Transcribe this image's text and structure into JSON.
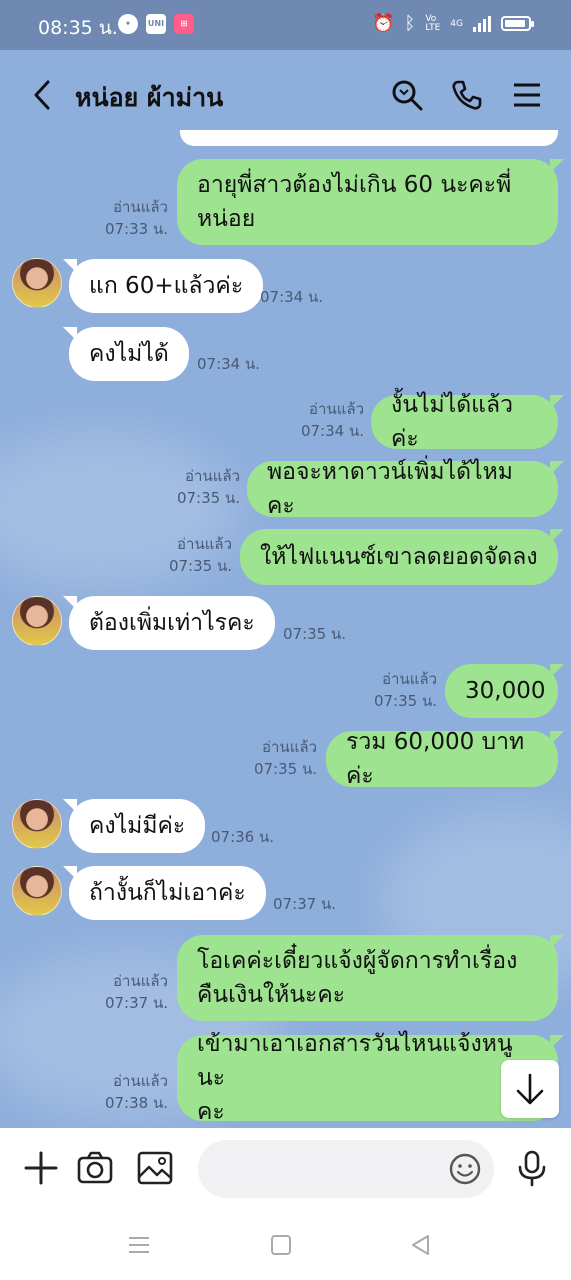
{
  "status": {
    "time": "08:35 น.",
    "net": "4G"
  },
  "chat": {
    "title": "หน่อย ผ้าม่าน"
  },
  "messages": [
    {
      "side": "right",
      "text_lines": [
        "อายุพี่สาวต้องไม่เกิน 60 นะคะพี่",
        "หน่อย"
      ],
      "read": "อ่านแล้ว",
      "time": "07:33 น."
    },
    {
      "side": "left",
      "text": "แก 60+แล้วค่ะ",
      "time": "07:34 น."
    },
    {
      "side": "left",
      "text": "คงไม่ได้",
      "time": "07:34 น."
    },
    {
      "side": "right",
      "text": "งั้นไม่ได้แล้วค่ะ",
      "read": "อ่านแล้ว",
      "time": "07:34 น."
    },
    {
      "side": "right",
      "text": "พอจะหาดาวน์เพิ่มได้ไหมคะ",
      "read": "อ่านแล้ว",
      "time": "07:35 น."
    },
    {
      "side": "right",
      "text": "ให้ไฟแนนซ์เขาลดยอดจัดลง",
      "read": "อ่านแล้ว",
      "time": "07:35 น."
    },
    {
      "side": "left",
      "text": "ต้องเพิ่มเท่าไรคะ",
      "time": "07:35 น."
    },
    {
      "side": "right",
      "text": "30,000",
      "read": "อ่านแล้ว",
      "time": "07:35 น."
    },
    {
      "side": "right",
      "text": "รวม 60,000 บาทค่ะ",
      "read": "อ่านแล้ว",
      "time": "07:35 น."
    },
    {
      "side": "left",
      "text": "คงไม่มีค่ะ",
      "time": "07:36 น."
    },
    {
      "side": "left",
      "text": "ถ้างั้นก็ไม่เอาค่ะ",
      "time": "07:37 น."
    },
    {
      "side": "right",
      "text_lines": [
        "โอเคค่ะเดี๋ยวแจ้งผู้จัดการทำเรื่อง",
        "คืนเงินให้นะคะ"
      ],
      "read": "อ่านแล้ว",
      "time": "07:37 น."
    },
    {
      "side": "right",
      "text_lines": [
        "เข้ามาเอาเอกสารวันไหนแจ้งหนูนะ",
        "คะ"
      ],
      "read": "อ่านแล้ว",
      "time": "07:38 น."
    }
  ],
  "input": {
    "value": ""
  }
}
